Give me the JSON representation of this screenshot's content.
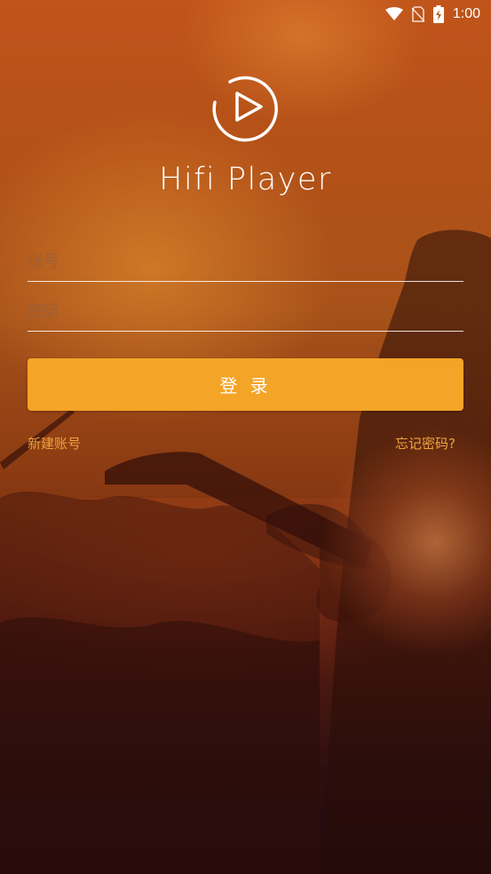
{
  "status_bar": {
    "time": "1:00",
    "icons": [
      "wifi-icon",
      "no-sim-icon",
      "battery-charging-icon"
    ]
  },
  "app": {
    "title": "Hifi Player",
    "logo_icon": "play-circle-icon"
  },
  "login_form": {
    "account_placeholder": "账号",
    "password_placeholder": "密码",
    "login_button_label": "登 录"
  },
  "links": {
    "register": "新建账号",
    "forgot_password": "忘记密码?"
  },
  "colors": {
    "accent": "#f4a427",
    "link": "#f0a43c",
    "text": "#ffffff"
  }
}
